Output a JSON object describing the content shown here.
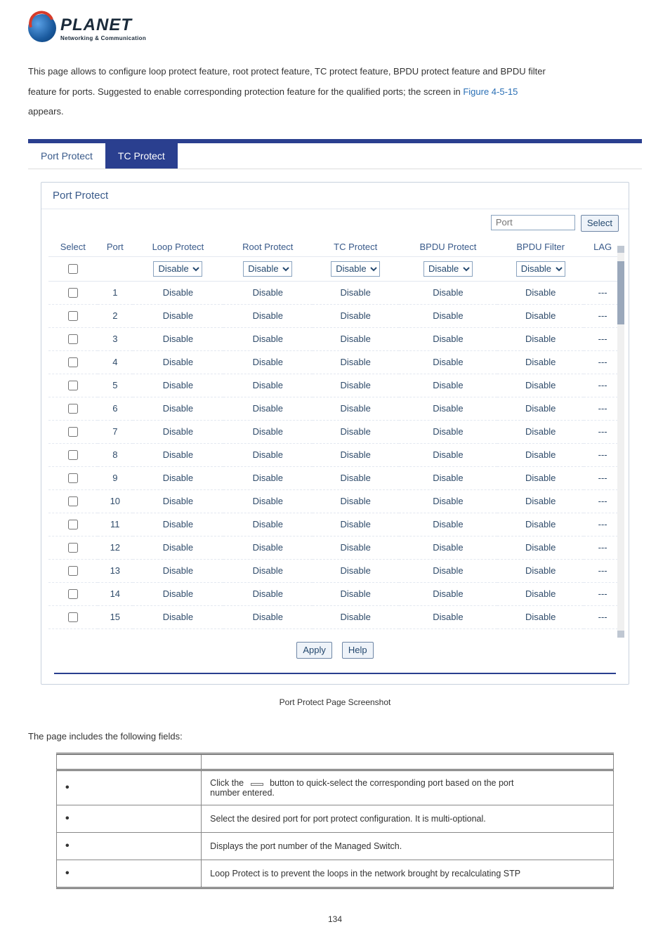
{
  "logo": {
    "brand": "PLANET",
    "tag": "Networking & Communication"
  },
  "intro": {
    "line1a": "This page allows to configure loop protect feature, root protect feature, TC protect feature, BPDU protect feature and BPDU filter",
    "line2a": "feature for ports. Suggested to enable corresponding protection feature for the qualified ports; the screen in ",
    "figref": "Figure 4-5-15",
    "line3": "appears."
  },
  "panel": {
    "tabs": {
      "port_protect": "Port Protect",
      "tc_protect": "TC Protect"
    },
    "title": "Port Protect",
    "toolbar": {
      "port_placeholder": "Port",
      "select_btn": "Select"
    },
    "columns": {
      "select": "Select",
      "port": "Port",
      "loop": "Loop Protect",
      "root": "Root Protect",
      "tc": "TC Protect",
      "bpdu_p": "BPDU Protect",
      "bpdu_f": "BPDU Filter",
      "lag": "LAG"
    },
    "header_row": {
      "disable_option": "Disable"
    },
    "rows": [
      {
        "port": "1",
        "loop": "Disable",
        "root": "Disable",
        "tc": "Disable",
        "bpdu_p": "Disable",
        "bpdu_f": "Disable",
        "lag": "---"
      },
      {
        "port": "2",
        "loop": "Disable",
        "root": "Disable",
        "tc": "Disable",
        "bpdu_p": "Disable",
        "bpdu_f": "Disable",
        "lag": "---"
      },
      {
        "port": "3",
        "loop": "Disable",
        "root": "Disable",
        "tc": "Disable",
        "bpdu_p": "Disable",
        "bpdu_f": "Disable",
        "lag": "---"
      },
      {
        "port": "4",
        "loop": "Disable",
        "root": "Disable",
        "tc": "Disable",
        "bpdu_p": "Disable",
        "bpdu_f": "Disable",
        "lag": "---"
      },
      {
        "port": "5",
        "loop": "Disable",
        "root": "Disable",
        "tc": "Disable",
        "bpdu_p": "Disable",
        "bpdu_f": "Disable",
        "lag": "---"
      },
      {
        "port": "6",
        "loop": "Disable",
        "root": "Disable",
        "tc": "Disable",
        "bpdu_p": "Disable",
        "bpdu_f": "Disable",
        "lag": "---"
      },
      {
        "port": "7",
        "loop": "Disable",
        "root": "Disable",
        "tc": "Disable",
        "bpdu_p": "Disable",
        "bpdu_f": "Disable",
        "lag": "---"
      },
      {
        "port": "8",
        "loop": "Disable",
        "root": "Disable",
        "tc": "Disable",
        "bpdu_p": "Disable",
        "bpdu_f": "Disable",
        "lag": "---"
      },
      {
        "port": "9",
        "loop": "Disable",
        "root": "Disable",
        "tc": "Disable",
        "bpdu_p": "Disable",
        "bpdu_f": "Disable",
        "lag": "---"
      },
      {
        "port": "10",
        "loop": "Disable",
        "root": "Disable",
        "tc": "Disable",
        "bpdu_p": "Disable",
        "bpdu_f": "Disable",
        "lag": "---"
      },
      {
        "port": "11",
        "loop": "Disable",
        "root": "Disable",
        "tc": "Disable",
        "bpdu_p": "Disable",
        "bpdu_f": "Disable",
        "lag": "---"
      },
      {
        "port": "12",
        "loop": "Disable",
        "root": "Disable",
        "tc": "Disable",
        "bpdu_p": "Disable",
        "bpdu_f": "Disable",
        "lag": "---"
      },
      {
        "port": "13",
        "loop": "Disable",
        "root": "Disable",
        "tc": "Disable",
        "bpdu_p": "Disable",
        "bpdu_f": "Disable",
        "lag": "---"
      },
      {
        "port": "14",
        "loop": "Disable",
        "root": "Disable",
        "tc": "Disable",
        "bpdu_p": "Disable",
        "bpdu_f": "Disable",
        "lag": "---"
      },
      {
        "port": "15",
        "loop": "Disable",
        "root": "Disable",
        "tc": "Disable",
        "bpdu_p": "Disable",
        "bpdu_f": "Disable",
        "lag": "---"
      }
    ],
    "actions": {
      "apply": "Apply",
      "help": "Help"
    }
  },
  "caption": "Port Protect Page Screenshot",
  "fields_intro": "The page includes the following fields:",
  "fields_table": {
    "header": {
      "object": "",
      "description": ""
    },
    "rows": [
      {
        "desc_pre": "Click the ",
        "btn": "",
        "desc_mid": " button to quick-select the corresponding port based on the port",
        "desc_line2": "number entered."
      },
      {
        "desc": "Select the desired port for port protect configuration. It is multi-optional."
      },
      {
        "desc": "Displays the port number of the Managed Switch."
      },
      {
        "desc": "Loop Protect is to prevent the loops in the network brought by recalculating STP"
      }
    ]
  },
  "page_number": "134"
}
